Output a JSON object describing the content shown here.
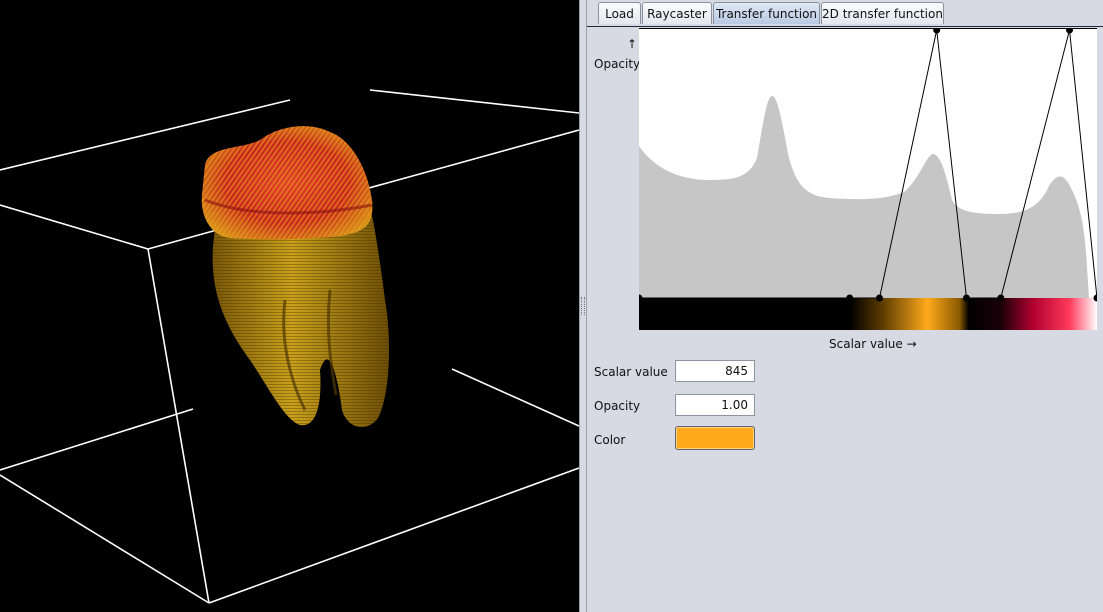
{
  "tabs": [
    {
      "label": "Load",
      "active": false
    },
    {
      "label": "Raycaster",
      "active": false
    },
    {
      "label": "Transfer function",
      "active": true
    },
    {
      "label": "2D transfer function",
      "active": false
    }
  ],
  "plot": {
    "y_axis_arrow": "↑",
    "y_axis_label": "Opacity",
    "x_axis_label": "Scalar value →"
  },
  "transfer_function": {
    "control_points": [
      {
        "scalar": 0.0,
        "opacity": 0.0
      },
      {
        "scalar": 0.46,
        "opacity": 0.0
      },
      {
        "scalar": 0.525,
        "opacity": 0.0
      },
      {
        "scalar": 0.65,
        "opacity": 1.0
      },
      {
        "scalar": 0.715,
        "opacity": 0.0
      },
      {
        "scalar": 0.79,
        "opacity": 0.0
      },
      {
        "scalar": 0.94,
        "opacity": 1.0
      },
      {
        "scalar": 1.0,
        "opacity": 0.0
      }
    ],
    "colors": {
      "accent_orange": "#ffaa1c",
      "deep_red": "#b00030",
      "pink": "#ff3a5a",
      "histogram_fill": "#c6c6c6"
    }
  },
  "fields": {
    "scalar_label": "Scalar value",
    "scalar_value": "845",
    "opacity_label": "Opacity",
    "opacity_value": "1.00",
    "color_label": "Color",
    "color_value": "#ffaa1c"
  }
}
